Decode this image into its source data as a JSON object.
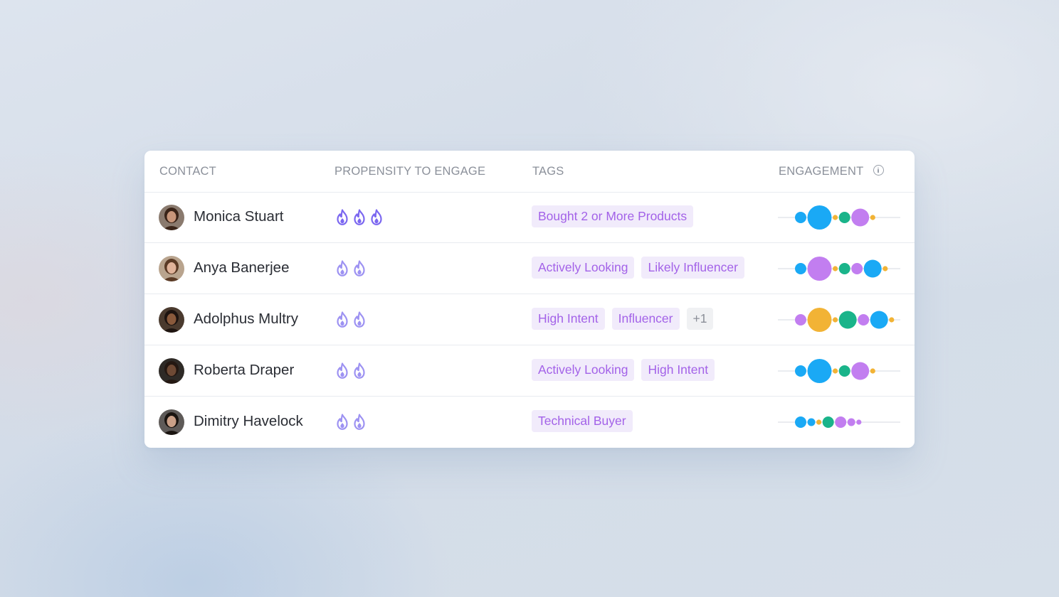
{
  "table": {
    "columns": {
      "contact": "CONTACT",
      "propensity": "PROPENSITY TO ENGAGE",
      "tags": "TAGS",
      "engagement": "ENGAGEMENT"
    },
    "colors": {
      "flame_strong": "#7b67f0",
      "flame_light": "#9d92f2",
      "tag_bg": "#f1ebfb",
      "tag_text": "#a362e8",
      "blue": "#1aa9f5",
      "purple": "#c27ef0",
      "green": "#1ab48a",
      "orange": "#f2b335"
    },
    "rows": [
      {
        "name": "Monica Stuart",
        "avatar": "avatar-photo",
        "propensity": 3,
        "tags": [
          "Bought 2 or More Products"
        ],
        "more": "",
        "engagement": [
          {
            "color": "blue",
            "size": 2
          },
          {
            "color": "blue",
            "size": 4
          },
          {
            "color": "orange",
            "size": 1
          },
          {
            "color": "green",
            "size": 2
          },
          {
            "color": "purple",
            "size": 3
          },
          {
            "color": "orange",
            "size": 1
          }
        ]
      },
      {
        "name": "Anya Banerjee",
        "avatar": "avatar-photo",
        "propensity": 2,
        "tags": [
          "Actively Looking",
          "Likely Influencer"
        ],
        "more": "",
        "engagement": [
          {
            "color": "blue",
            "size": 2
          },
          {
            "color": "purple",
            "size": 4
          },
          {
            "color": "orange",
            "size": 1
          },
          {
            "color": "green",
            "size": 2
          },
          {
            "color": "purple",
            "size": 2
          },
          {
            "color": "blue",
            "size": 3
          },
          {
            "color": "orange",
            "size": 1
          }
        ]
      },
      {
        "name": "Adolphus Multry",
        "avatar": "avatar-photo",
        "propensity": 2,
        "tags": [
          "High Intent",
          "Influencer"
        ],
        "more": "+1",
        "engagement": [
          {
            "color": "purple",
            "size": 2
          },
          {
            "color": "orange",
            "size": 4
          },
          {
            "color": "orange",
            "size": 1
          },
          {
            "color": "green",
            "size": 3
          },
          {
            "color": "purple",
            "size": 2
          },
          {
            "color": "blue",
            "size": 3
          },
          {
            "color": "orange",
            "size": 1
          }
        ]
      },
      {
        "name": "Roberta Draper",
        "avatar": "avatar-photo",
        "propensity": 2,
        "tags": [
          "Actively Looking",
          "High Intent"
        ],
        "more": "",
        "engagement": [
          {
            "color": "blue",
            "size": 2
          },
          {
            "color": "blue",
            "size": 4
          },
          {
            "color": "orange",
            "size": 1
          },
          {
            "color": "green",
            "size": 2
          },
          {
            "color": "purple",
            "size": 3
          },
          {
            "color": "orange",
            "size": 1
          }
        ]
      },
      {
        "name": "Dimitry Havelock",
        "avatar": "avatar-photo",
        "propensity": 2,
        "tags": [
          "Technical Buyer"
        ],
        "more": "",
        "engagement": [
          {
            "color": "blue",
            "size": 2
          },
          {
            "color": "blue",
            "size": 1.5
          },
          {
            "color": "orange",
            "size": 1
          },
          {
            "color": "green",
            "size": 2
          },
          {
            "color": "purple",
            "size": 2
          },
          {
            "color": "purple",
            "size": 1.5
          },
          {
            "color": "purple",
            "size": 1
          }
        ]
      }
    ]
  }
}
